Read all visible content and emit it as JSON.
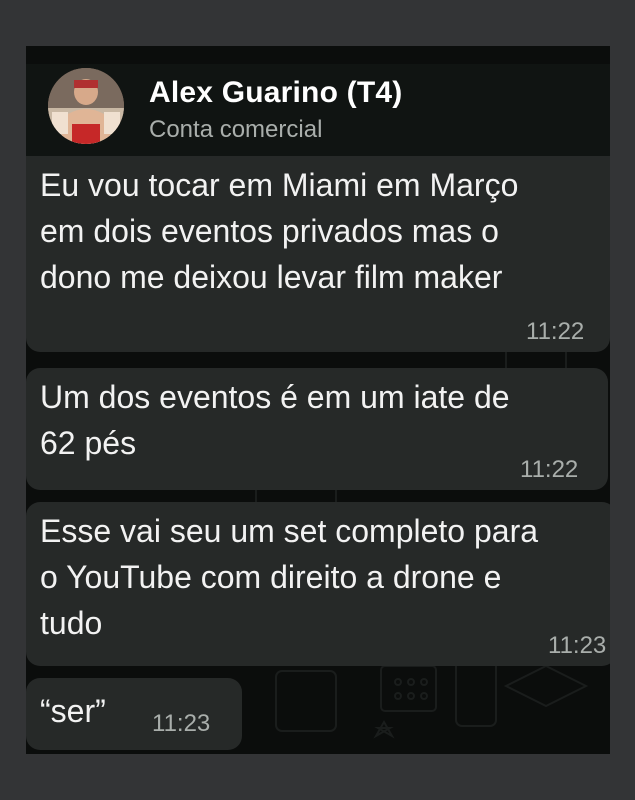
{
  "header": {
    "name": "Alex Guarino (T4)",
    "subtitle": "Conta comercial"
  },
  "messages": [
    {
      "lines": [
        "Eu vou tocar em Miami em Março",
        "em dois eventos privados mas o",
        "dono me deixou levar film maker"
      ],
      "time": "11:22"
    },
    {
      "lines": [
        "Um dos eventos é em um iate de",
        "62 pés"
      ],
      "time": "11:22"
    },
    {
      "lines": [
        "Esse vai seu um set completo para",
        "o YouTube com direito a drone e",
        "tudo"
      ],
      "time": "11:23"
    },
    {
      "lines": [
        "“ser”"
      ],
      "time": "11:23"
    }
  ],
  "colors": {
    "background": "#333436",
    "chat_background": "#0b0d0c",
    "bubble": "#262928",
    "text": "#f2f2f2",
    "muted": "#a9aeab"
  }
}
